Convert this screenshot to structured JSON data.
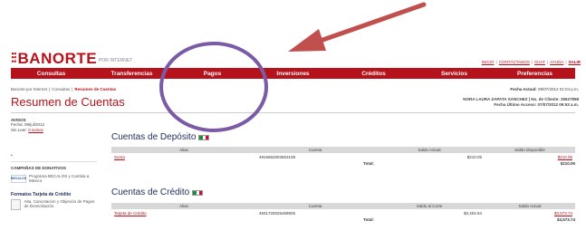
{
  "header": {
    "logo_text": "BANORTE",
    "logo_sub": "POR INTERNET",
    "top_links": [
      "INICIO",
      "CONTÁCTANOS",
      "CHAT",
      "AYUDA",
      "SALIR"
    ]
  },
  "nav": {
    "items": [
      "Consultas",
      "Transferencias",
      "Pagos",
      "Inversiones",
      "Créditos",
      "Servicios",
      "Preferencias"
    ]
  },
  "breadcrumb": {
    "items": [
      "Banorte por Internet",
      "Consultas",
      "Resumen de Cuentas"
    ]
  },
  "date_info": {
    "label": "Fecha Actual:",
    "value": "09/07/2012 01:04 p.m."
  },
  "page_title": "Resumen de Cuentas",
  "user": {
    "line1": "NORA LAURA ZAPATA SANCHEZ | No. de Cliente: 25627858",
    "line2": "Fecha Último Acceso: 07/07/2012 09:53 a.m."
  },
  "sidebar": {
    "avisos_title": "AVISOS",
    "fecha_line": "Fecha: 09/jul/2012",
    "leer_label": "Sin Leer:",
    "leer_link": "0 avisos",
    "bullet": "•",
    "campanas_title": "CAMPAÑAS DE DONATIVOS",
    "promo_logo": "BECALOS",
    "promo_text": "Programa BECALOS y Cambia a México",
    "formatos_title": "Formatos Tarjeta de Crédito",
    "formatos_text": "Alta, Cancelación y Objeción de Pagos de Domiciliación."
  },
  "deposito": {
    "title": "Cuentas de Depósito",
    "headers": [
      "Alias",
      "Cuenta",
      "Saldo Actual",
      "Saldo Disponible"
    ],
    "rows": [
      {
        "alias": "Suma",
        "cuenta": "4915662003663108",
        "saldo_actual": "$210.05",
        "saldo_disponible": "$210.05"
      }
    ],
    "total_label": "Total:",
    "total_value": "$210.05"
  },
  "credito": {
    "title": "Cuentas de Crédito",
    "headers": [
      "Alias",
      "Cuenta",
      "Saldo al Corte",
      "Saldo Actual"
    ],
    "rows": [
      {
        "alias": "Tarjeta de Crédito",
        "cuenta": "4931720025459925",
        "saldo_corte": "$3,404.54",
        "saldo_actual": "$3,573.74"
      }
    ],
    "total_label": "Total:",
    "total_value": "$3,573.74"
  },
  "colors": {
    "brand_red": "#b5121b",
    "heading_blue": "#1e2d5a",
    "annotation_arrow": "#c0504d",
    "annotation_ellipse": "#7b5ba6"
  }
}
